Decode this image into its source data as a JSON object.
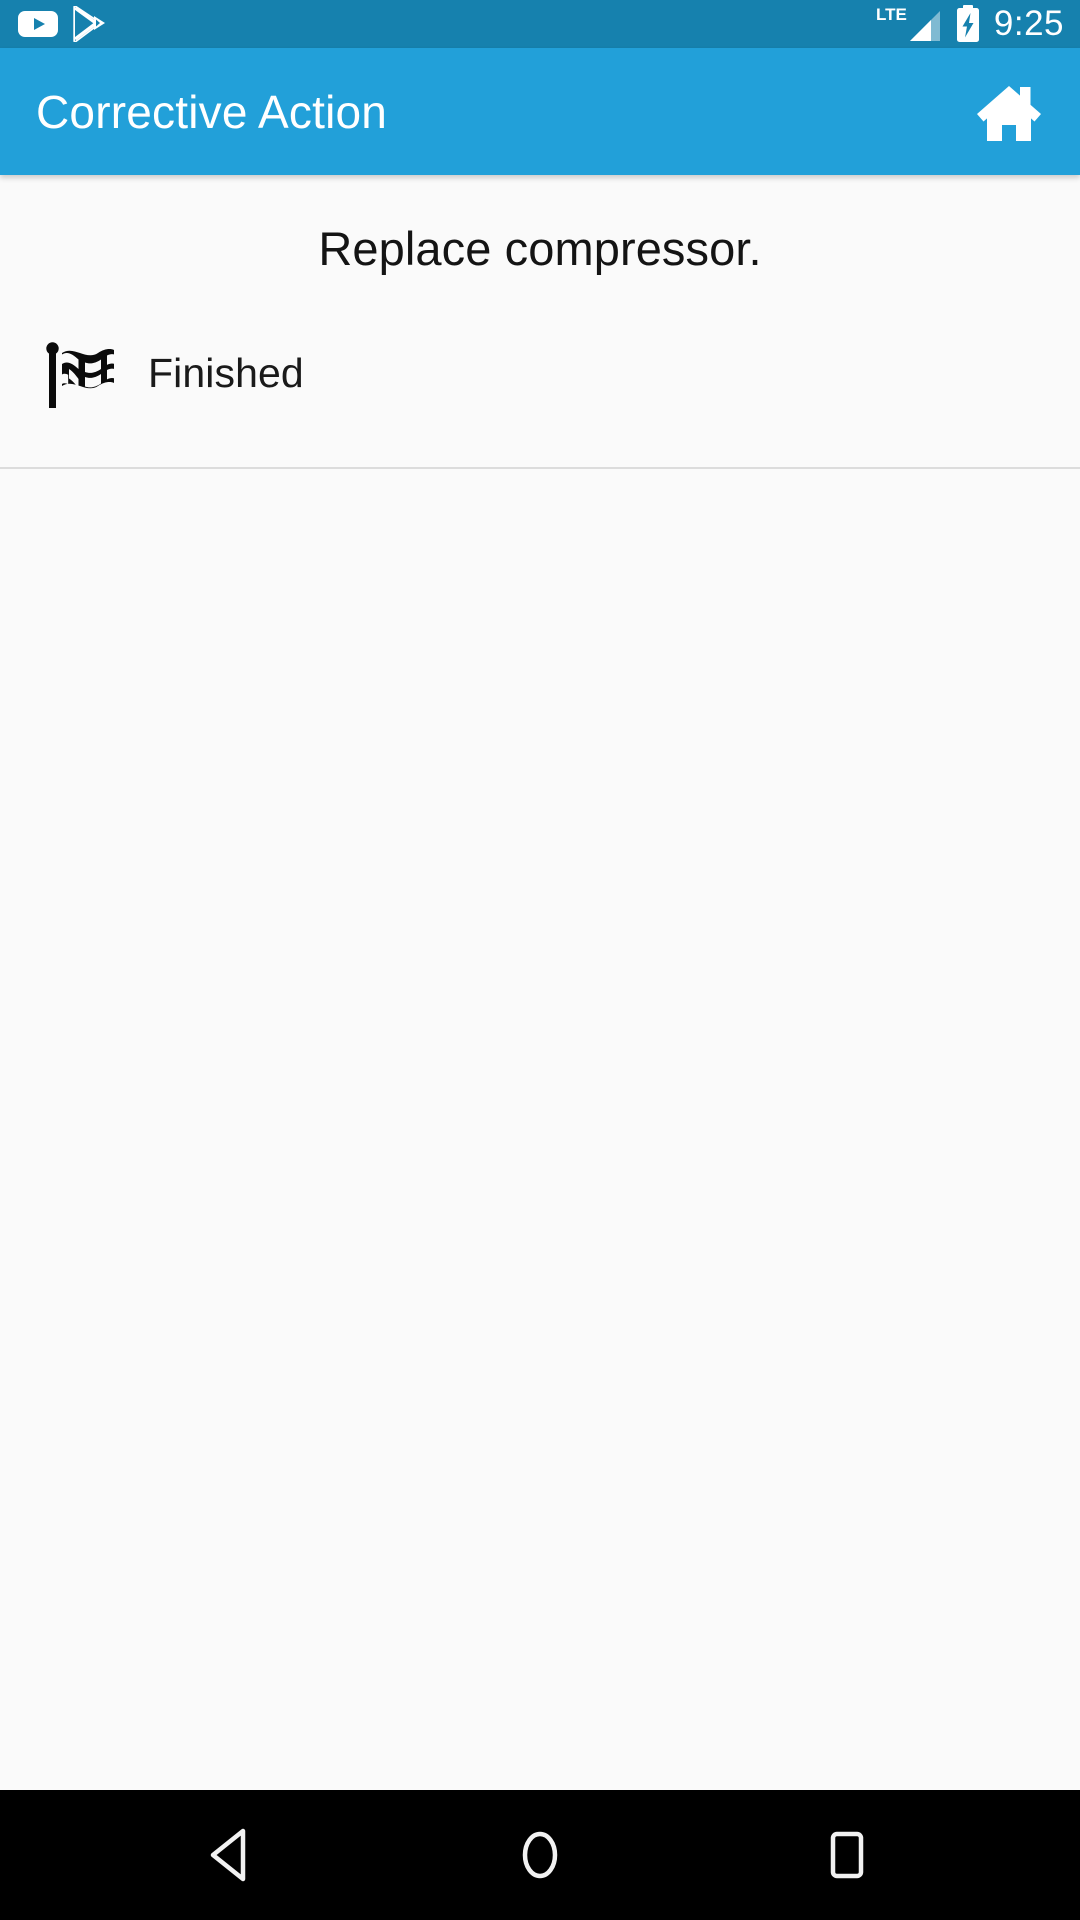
{
  "status_bar": {
    "background_color": "#1681ae",
    "clock": "9:25",
    "notifications": [
      {
        "name": "youtube-notification-icon",
        "label": "YouTube"
      },
      {
        "name": "play-store-notification-icon",
        "label": "Google Play Store"
      }
    ],
    "indicators": [
      {
        "name": "lte-signal-icon",
        "label": "LTE"
      },
      {
        "name": "battery-charging-icon",
        "label": "Battery charging"
      }
    ]
  },
  "app_bar": {
    "background_color": "#22a0d9",
    "title": "Corrective Action",
    "home_action_label": "Home"
  },
  "content": {
    "background_color": "#fafafa",
    "action_text": "Replace compressor.",
    "status_item": {
      "icon": "checkered-flag-icon",
      "label": "Finished"
    }
  },
  "nav_bar": {
    "background_color": "#000000",
    "buttons": [
      {
        "name": "nav-back-button",
        "label": "Back"
      },
      {
        "name": "nav-home-button",
        "label": "Home"
      },
      {
        "name": "nav-recents-button",
        "label": "Recents"
      }
    ]
  }
}
